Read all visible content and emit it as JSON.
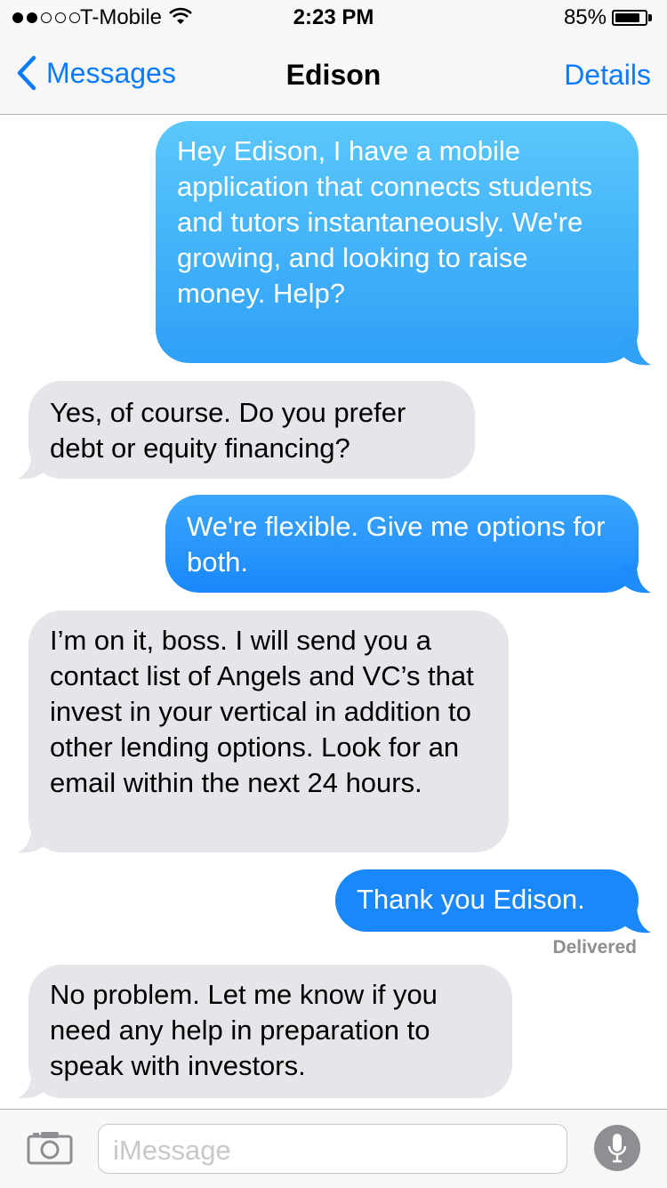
{
  "status": {
    "carrier": "T-Mobile",
    "time": "2:23 PM",
    "battery_pct": "85%",
    "signal_bars": 2
  },
  "nav": {
    "back_label": "Messages",
    "title": "Edison",
    "details_label": "Details"
  },
  "messages": [
    {
      "direction": "sent",
      "text": "Hey Edison, I have a mobile application that connects students and tutors instantaneously. We're growing, and looking to raise money. Help?"
    },
    {
      "direction": "received",
      "text": "Yes, of course. Do you prefer debt or equity financing?"
    },
    {
      "direction": "sent",
      "text": "We're flexible. Give me options for both."
    },
    {
      "direction": "received",
      "text": "I’m on it, boss. I will send you a contact list of Angels and VC’s that invest in your vertical in addition to other lending options. Look for an email within the next 24 hours."
    },
    {
      "direction": "sent",
      "text": "Thank you Edison."
    },
    {
      "direction": "received",
      "text": "No problem. Let me know if you need any help in preparation to speak with investors."
    }
  ],
  "delivered_label": "Delivered",
  "input": {
    "placeholder": "iMessage"
  },
  "colors": {
    "accent": "#0a7aff",
    "sent_bubble": "#1e8dfb",
    "received_bubble": "#e5e5ea"
  },
  "icons": {
    "back": "chevron-left-icon",
    "camera": "camera-icon",
    "mic": "microphone-icon",
    "wifi": "wifi-icon",
    "battery": "battery-icon"
  }
}
